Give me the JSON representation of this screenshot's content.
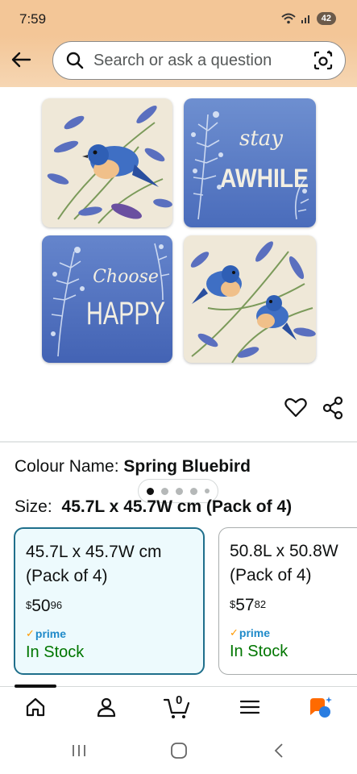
{
  "status_bar": {
    "time": "7:59",
    "battery": "42"
  },
  "search": {
    "placeholder": "Search or ask a question"
  },
  "gallery": {
    "pillows": [
      {
        "caption": "",
        "theme": "bluebird-lavender"
      },
      {
        "caption": [
          "stay",
          "AWHILE"
        ],
        "theme": "blue-text"
      },
      {
        "caption": [
          "Choose",
          "HAPPY"
        ],
        "theme": "blue-text"
      },
      {
        "caption": "",
        "theme": "two-bluebirds"
      }
    ],
    "dot_count": 5,
    "active_dot": 0
  },
  "variation": {
    "colour_label": "Colour Name:",
    "colour_value": "Spring Bluebird",
    "size_label": "Size:",
    "size_value": "45.7L x 45.7W cm (Pack of 4)"
  },
  "size_options": [
    {
      "line1": "45.7L x 45.7W cm",
      "line2": "(Pack of 4)",
      "currency": "$",
      "price_whole": "50",
      "price_fraction": "96",
      "prime": "prime",
      "stock": "In Stock",
      "selected": true
    },
    {
      "line1": "50.8L x 50.8W",
      "line2": "(Pack of 4)",
      "currency": "$",
      "price_whole": "57",
      "price_fraction": "82",
      "prime": "prime",
      "stock": "In Stock",
      "selected": false
    }
  ],
  "bottom_nav": {
    "cart_count": "0",
    "items": [
      "home-icon",
      "account-icon",
      "cart-icon",
      "menu-icon",
      "rufus-icon"
    ]
  },
  "colors": {
    "header": "#f3c697",
    "selected_border": "#1f6f8b",
    "selected_bg": "#edfafd",
    "stock_green": "#007600",
    "prime_blue": "#1f8ac9",
    "rufus_orange": "#ff6a00",
    "rufus_blue": "#2a7de1"
  }
}
